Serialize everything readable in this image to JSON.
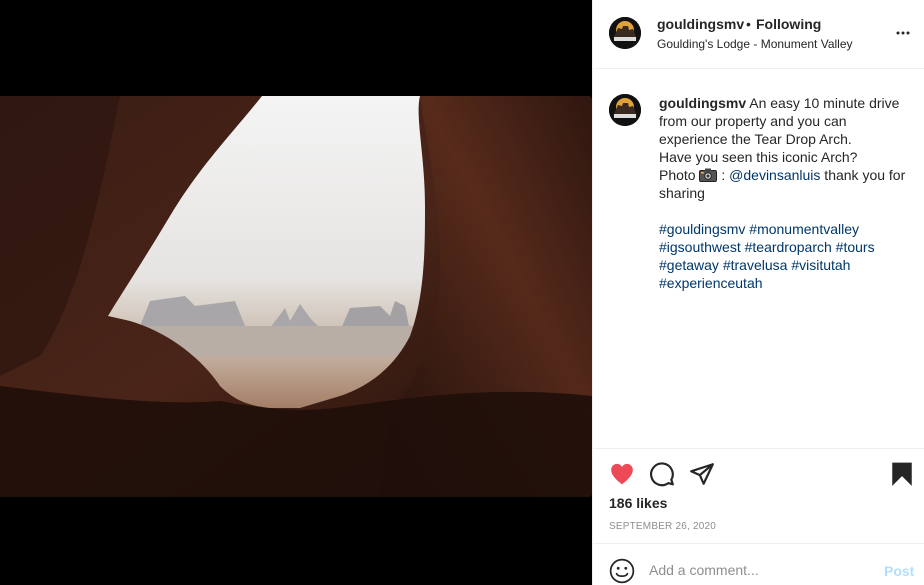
{
  "post": {
    "username": "gouldingsmv",
    "separator": "•",
    "follow_status": "Following",
    "location": "Goulding's Lodge - Monument Valley",
    "avatar_text": "GOULDING'S"
  },
  "caption": {
    "username": "gouldingsmv",
    "line1": " An easy 10 minute drive from our property and you can experience the Tear Drop Arch.",
    "line2": "Have you seen this iconic Arch?",
    "photo_prefix": "Photo ",
    "photo_sep": " : ",
    "mention": "@devinsanluis",
    "thanks": " thank you for sharing",
    "hashtags": [
      "#gouldingsmv",
      "#monumentvalley",
      "#igsouthwest",
      "#teardroparch",
      "#tours",
      "#getaway",
      "#travelusa",
      "#visitutah",
      "#experienceutah"
    ]
  },
  "actions": {
    "likes": "186 likes",
    "date": "SEPTEMBER 26, 2020",
    "liked": true,
    "saved": true,
    "like_color": "#ed4956"
  },
  "comment_bar": {
    "placeholder": "Add a comment...",
    "post_label": "Post"
  },
  "icons": [
    "more-options-icon",
    "heart-icon",
    "comment-icon",
    "share-icon",
    "bookmark-icon",
    "emoji-icon",
    "camera-icon"
  ]
}
